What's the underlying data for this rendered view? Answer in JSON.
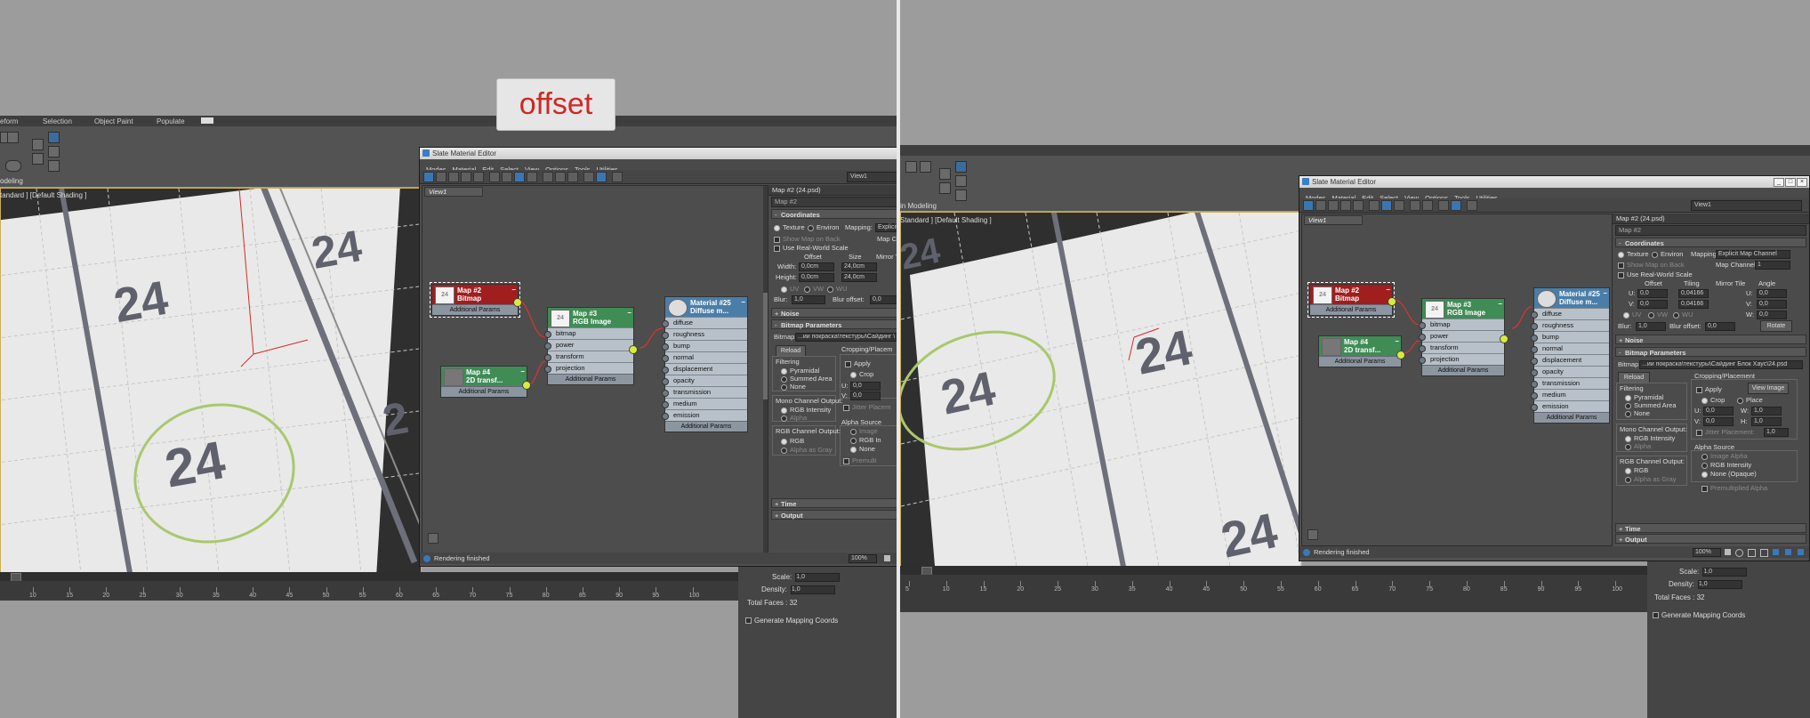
{
  "banner": {
    "text": "offset"
  },
  "max": {
    "ribbon_tabs": [
      "eform",
      "Selection",
      "Object Paint",
      "Populate"
    ],
    "mode_left": "odeling",
    "mode_right": "in Modeling",
    "viewport_label": "tandard ] [Default Shading ]",
    "viewport_label_right": "Standard ] [Default Shading ]",
    "floor_number": "24",
    "timeline_left": [
      "10",
      "15",
      "20",
      "25",
      "30",
      "35",
      "40",
      "45",
      "50",
      "55",
      "60",
      "65",
      "70",
      "75",
      "80",
      "85",
      "90",
      "95",
      "100"
    ],
    "timeline_right": [
      "5",
      "10",
      "15",
      "20",
      "25",
      "30",
      "35",
      "40",
      "45",
      "50",
      "55",
      "60",
      "65",
      "70",
      "75",
      "80",
      "85",
      "90",
      "95",
      "100"
    ],
    "cmd": {
      "scale_label": "Scale:",
      "scale_value": "1,0",
      "density_label": "Density:",
      "density_value": "1,0",
      "faces": "Total Faces : 32",
      "gen": "Generate Mapping Coords"
    }
  },
  "slate": {
    "title": "Slate Material Editor",
    "menus": [
      "Modes",
      "Material",
      "Edit",
      "Select",
      "View",
      "Options",
      "Tools",
      "Utilities"
    ],
    "view_combo": "View1",
    "view_tab": "View1",
    "status": "Rendering finished",
    "zoom": "100%",
    "nodes": {
      "map2": {
        "title1": "Map #2",
        "title2": "Bitmap",
        "add": "Additional Params"
      },
      "map3": {
        "title1": "Map #3",
        "title2": "RGB Image",
        "slots": [
          "bitmap",
          "power",
          "transform",
          "projection"
        ],
        "add": "Additional Params"
      },
      "map4": {
        "title1": "Map #4",
        "title2": "2D transf...",
        "add": "Additional Params"
      },
      "mat25": {
        "title1": "Material #25",
        "title2": "Diffuse m...",
        "slots": [
          "diffuse",
          "roughness",
          "bump",
          "normal",
          "displacement",
          "opacity",
          "transmission",
          "medium",
          "emission"
        ],
        "add": "Additional Params"
      }
    },
    "props": {
      "title": "Map #2 (24.psd)",
      "name": "Map #2",
      "coordinates": "Coordinates",
      "texture": "Texture",
      "environ": "Environ",
      "mapping_label": "Mapping:",
      "mapping_left": "Explicit M",
      "mapping_right": "Explicit Map Channel",
      "map_channel_left": "Map Chan",
      "map_channel_right": "Map Channel:",
      "map_channel_value": "1",
      "show_map": "Show Map on Back",
      "real_world": "Use Real-World Scale",
      "offset": "Offset",
      "size": "Size",
      "tiling": "Tiling",
      "mirror_tile": "Mirror Tile",
      "angle": "Angle",
      "width_label": "Width:",
      "height_label": "Height:",
      "width_offset": "0,0cm",
      "width_size": "24,0cm",
      "height_offset": "0,0cm",
      "height_size": "24,0cm",
      "u_label": "U:",
      "v_label": "V:",
      "w_label": "W:",
      "u_offset": "0,0",
      "v_offset": "0,0",
      "u_tiling": "0,04166",
      "v_tiling": "0,04166",
      "u_angle": "0,0",
      "v_angle": "0,0",
      "w_angle": "0,0",
      "uv": "UV",
      "vw": "VW",
      "wu": "WU",
      "blur_label": "Blur:",
      "blur": "1,0",
      "blur_offset_label": "Blur offset:",
      "blur_offset": "0,0",
      "rotate": "Rotate",
      "noise": "Noise",
      "bitmap_params": "Bitmap Parameters",
      "bitmap_label": "Bitmap:",
      "bitmap_path_left": "...ии покраска\\текстуры\\Сайдинг \\",
      "bitmap_path_right": "...ии покраска\\текстуры\\Сайдинг Блок Хаус\\24.psd",
      "reload": "Reload",
      "cropping": "Cropping/Placement",
      "cropping_left": "Cropping/Placem",
      "apply": "Apply",
      "view_image": "View Image",
      "crop": "Crop",
      "place": "Place",
      "cu_label": "U:",
      "cv_label": "V:",
      "cw_label": "W:",
      "ch_label": "H:",
      "cu": "0,0",
      "cv": "0,0",
      "cw": "1,0",
      "ch": "1,0",
      "jitter": "Jitter Placement:",
      "jitter_left": "Jitter Placem",
      "jitter_value": "1,0",
      "filtering": "Filtering",
      "pyramidal": "Pyramidal",
      "summed": "Summed Area",
      "none": "None",
      "mono": "Mono Channel Output:",
      "rgb_int": "RGB Intensity",
      "alpha": "Alpha",
      "rgb_out": "RGB Channel Output:",
      "rgb": "RGB",
      "alpha_gray": "Alpha as Gray",
      "alpha_source": "Alpha Source",
      "image_alpha": "Image Alpha",
      "image_left": "Image",
      "rgb_left": "RGB In",
      "none_left": "None",
      "none_opaque": "None (Opaque)",
      "premult": "Premultiplied Alpha",
      "premult_left": "Premulti",
      "time": "Time",
      "output": "Output"
    }
  },
  "colors": {
    "accent": "#3b76b4",
    "viewport_border": "#ccae56",
    "banner_text": "#cc2a22"
  }
}
